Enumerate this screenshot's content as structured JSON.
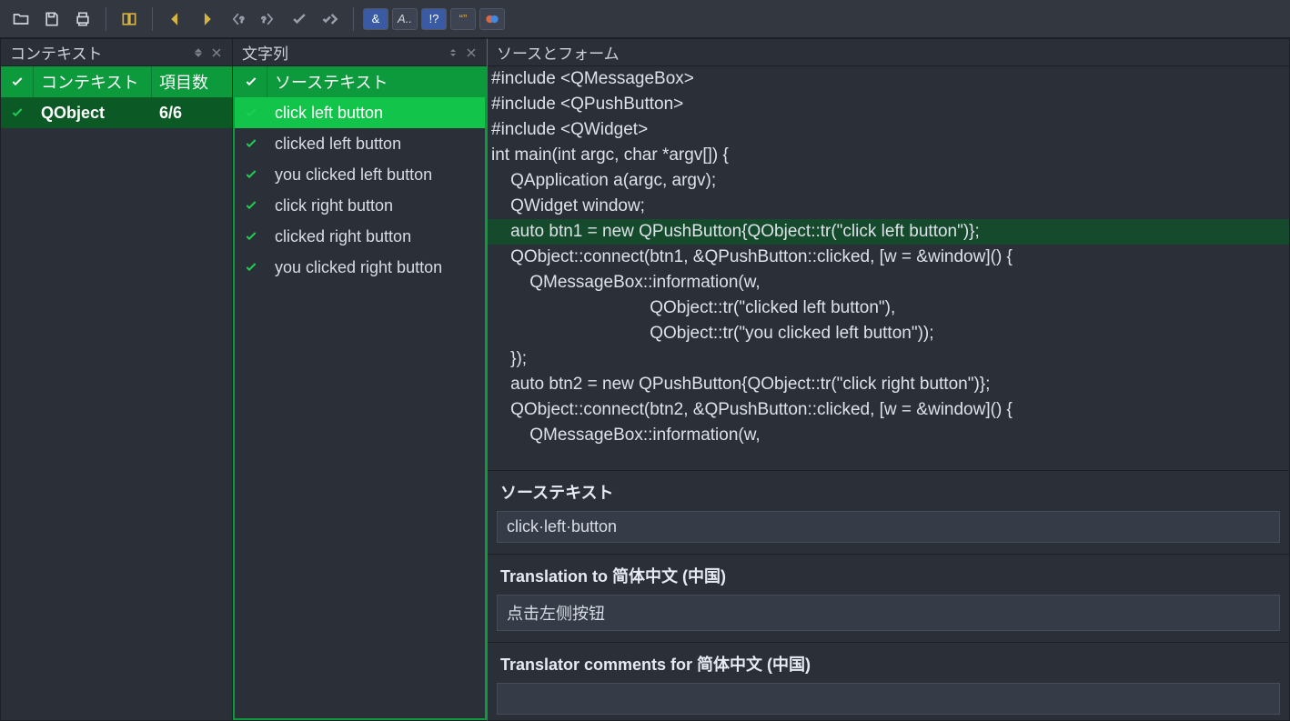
{
  "panels": {
    "context": {
      "title": "コンテキスト",
      "col_status": "✓",
      "col_context": "コンテキスト",
      "col_items": "項目数"
    },
    "strings": {
      "title": "文字列",
      "col_status": "✓",
      "col_source": "ソーステキスト"
    },
    "source_form": {
      "title": "ソースとフォーム"
    }
  },
  "context_rows": [
    {
      "name": "QObject",
      "count": "6/6",
      "selected": true
    }
  ],
  "string_rows": [
    {
      "text": "click left button",
      "selected": true
    },
    {
      "text": "clicked left button"
    },
    {
      "text": "you clicked left button"
    },
    {
      "text": "click right button"
    },
    {
      "text": "clicked right button"
    },
    {
      "text": "you clicked right button"
    }
  ],
  "code_lines": [
    {
      "t": "#include <QMessageBox>"
    },
    {
      "t": "#include <QPushButton>"
    },
    {
      "t": "#include <QWidget>"
    },
    {
      "t": ""
    },
    {
      "t": "int main(int argc, char *argv[]) {"
    },
    {
      "t": "    QApplication a(argc, argv);"
    },
    {
      "t": "    QWidget window;"
    },
    {
      "t": "    auto btn1 = new QPushButton{QObject::tr(\"click left button\")};",
      "hl": true
    },
    {
      "t": "    QObject::connect(btn1, &QPushButton::clicked, [w = &window]() {"
    },
    {
      "t": "        QMessageBox::information(w,"
    },
    {
      "t": "                                 QObject::tr(\"clicked left button\"),"
    },
    {
      "t": "                                 QObject::tr(\"you clicked left button\"));"
    },
    {
      "t": "    });"
    },
    {
      "t": "    auto btn2 = new QPushButton{QObject::tr(\"click right button\")};"
    },
    {
      "t": "    QObject::connect(btn2, &QPushButton::clicked, [w = &window]() {"
    },
    {
      "t": "        QMessageBox::information(w,"
    }
  ],
  "translation": {
    "source_label": "ソーステキスト",
    "source_value": "click·left·button",
    "target_label": "Translation to 简体中文 (中国)",
    "target_value": "点击左侧按钮",
    "comments_label": "Translator comments for 简体中文 (中国)",
    "comments_value": ""
  }
}
